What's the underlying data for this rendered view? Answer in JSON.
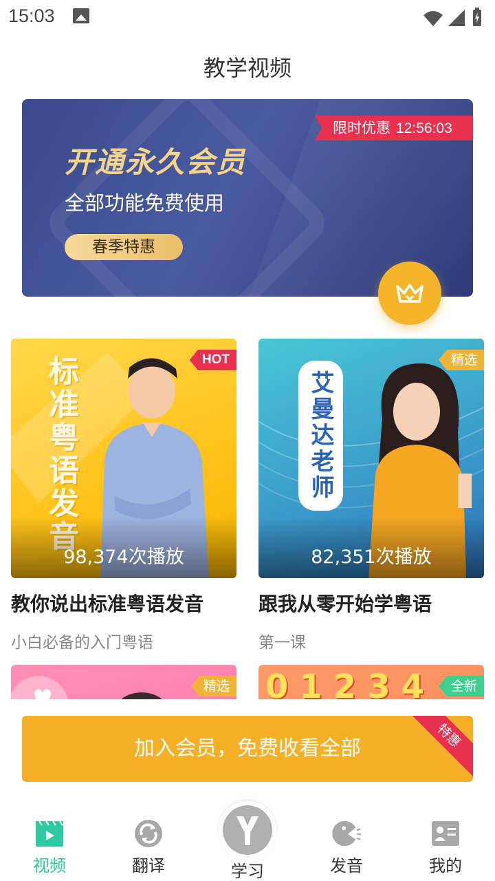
{
  "status_bar": {
    "time": "15:03"
  },
  "header": {
    "title": "教学视频"
  },
  "banner": {
    "ribbon_label": "限时优惠",
    "ribbon_timer": "12:56:03",
    "headline": "开通永久会员",
    "subtitle": "全部功能免费使用",
    "pill_label": "春季特惠"
  },
  "cards": [
    {
      "tag": "HOT",
      "thumb_text": "标准粤语发音",
      "plays": "98,374次播放",
      "title": "教你说出标准粤语发音",
      "subtitle": "小白必备的入门粤语"
    },
    {
      "tag": "精选",
      "thumb_text": "艾曼达老师",
      "plays": "82,351次播放",
      "title": "跟我从零开始学粤语",
      "subtitle": "第一课"
    },
    {
      "tag": "精选"
    },
    {
      "tag": "全新",
      "thumb_text": "01234"
    }
  ],
  "member_bar": {
    "label": "加入会员，免费收看全部",
    "corner": "特惠"
  },
  "bottom_nav": {
    "items": [
      {
        "label": "视频"
      },
      {
        "label": "翻译"
      },
      {
        "label": "学习"
      },
      {
        "label": "发音"
      },
      {
        "label": "我的"
      }
    ]
  },
  "colors": {
    "accent": "#2ec9a0",
    "gold": "#f5b028",
    "red": "#e8314f",
    "banner": "#3a4a8c"
  }
}
